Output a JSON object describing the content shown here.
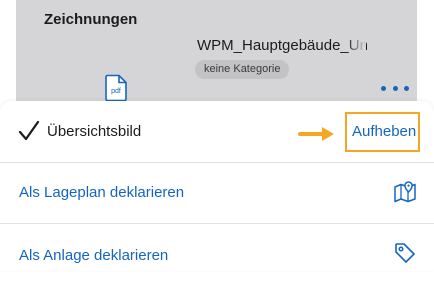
{
  "background": {
    "section_title": "Zeichnungen",
    "file": {
      "name": "WPM_Hauptgebäude_Un",
      "category": "keine Kategorie",
      "icon": "pdf-file-icon",
      "icon_text": "pdf"
    },
    "more_icon": "more-horizontal-icon"
  },
  "sheet": {
    "selected_item": {
      "label": "Übersichtsbild",
      "icon": "checkmark-icon",
      "action_label": "Aufheben",
      "annotation_arrow": "arrow-right-icon",
      "annotation_color": "#f5a623"
    },
    "actions": [
      {
        "label": "Als Lageplan deklarieren",
        "icon": "map-pin-icon"
      },
      {
        "label": "Als Anlage deklarieren",
        "icon": "tag-icon"
      }
    ]
  },
  "colors": {
    "accent": "#1565c0",
    "annotation": "#f5a623",
    "backdrop": "#d5d5d7"
  }
}
